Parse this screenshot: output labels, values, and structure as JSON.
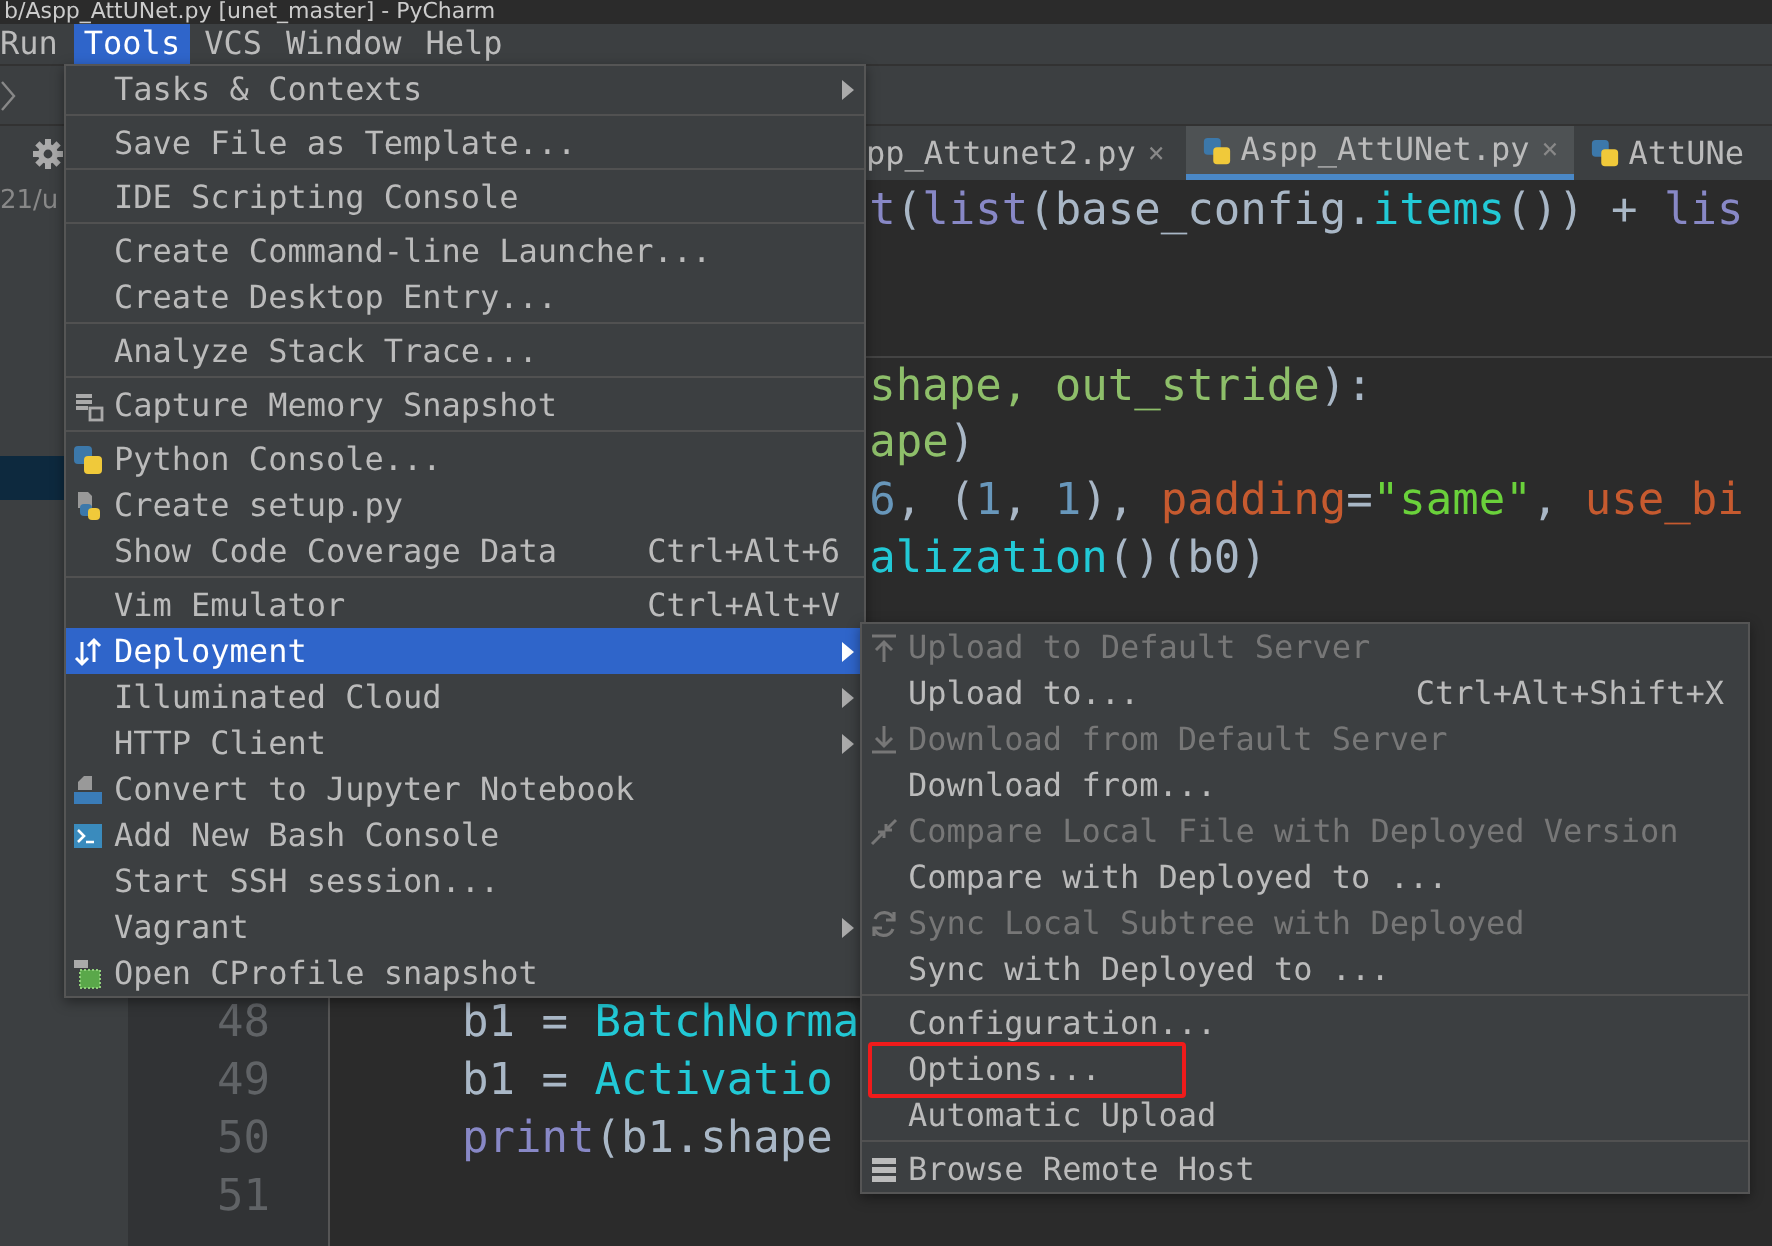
{
  "window": {
    "title": "b/Aspp_AttUNet.py [unet_master] - PyCharm"
  },
  "menu_bar": [
    {
      "label": "Run",
      "selected": false
    },
    {
      "label": "Tools",
      "selected": true
    },
    {
      "label": "VCS",
      "selected": false
    },
    {
      "label": "Window",
      "selected": false
    },
    {
      "label": "Help",
      "selected": false
    }
  ],
  "editor_tabs": [
    {
      "label": "pp_Attunet2.py",
      "selected": false,
      "file_icon": false,
      "close": "×"
    },
    {
      "label": "Aspp_AttUNet.py",
      "selected": true,
      "file_icon": true,
      "close": "×"
    },
    {
      "label": "AttUNe",
      "selected": false,
      "file_icon": true
    }
  ],
  "project_panel": {
    "path_fragment": "21/u",
    "has_selection": true
  },
  "editor": {
    "lines": [
      {
        "tokens": [
          {
            "kind": "builtin",
            "text": "t"
          },
          {
            "kind": "name",
            "text": "("
          },
          {
            "kind": "builtin",
            "text": "list"
          },
          {
            "kind": "name",
            "text": "(base_config."
          },
          {
            "kind": "call",
            "text": "items"
          },
          {
            "kind": "name",
            "text": "()) + "
          },
          {
            "kind": "builtin",
            "text": "lis"
          }
        ]
      },
      {
        "tokens": [
          {
            "kind": "param",
            "text": "shape, out_stride"
          },
          {
            "kind": "name",
            "text": "):"
          }
        ]
      },
      {
        "tokens": [
          {
            "kind": "param",
            "text": "ape"
          },
          {
            "kind": "name",
            "text": ")"
          }
        ]
      },
      {
        "tokens": [
          {
            "kind": "number",
            "text": "6"
          },
          {
            "kind": "name",
            "text": ", ("
          },
          {
            "kind": "number",
            "text": "1"
          },
          {
            "kind": "name",
            "text": ", "
          },
          {
            "kind": "number",
            "text": "1"
          },
          {
            "kind": "name",
            "text": "), "
          },
          {
            "kind": "kwarg",
            "text": "padding"
          },
          {
            "kind": "name",
            "text": "="
          },
          {
            "kind": "string",
            "text": "\"same\""
          },
          {
            "kind": "name",
            "text": ", "
          },
          {
            "kind": "kwarg",
            "text": "use_bi"
          }
        ]
      },
      {
        "tokens": [
          {
            "kind": "call",
            "text": "alization"
          },
          {
            "kind": "name",
            "text": "()(b0)"
          }
        ]
      },
      {
        "number": "48",
        "tokens": [
          {
            "kind": "name",
            "text": "b1 = "
          },
          {
            "kind": "call",
            "text": "BatchNorma"
          }
        ]
      },
      {
        "number": "49",
        "tokens": [
          {
            "kind": "name",
            "text": "b1 = "
          },
          {
            "kind": "call",
            "text": "Activatio"
          }
        ]
      },
      {
        "number": "50",
        "tokens": [
          {
            "kind": "builtin",
            "text": "print"
          },
          {
            "kind": "name",
            "text": "(b1.shape"
          }
        ]
      },
      {
        "number": "51"
      }
    ]
  },
  "tools_menu": {
    "items": [
      {
        "kind": "plain",
        "label": "Tasks & Contexts",
        "submenu": true,
        "selected": false
      },
      {
        "kind": "separator"
      },
      {
        "kind": "plain",
        "label": "Save File as Template...",
        "submenu": false,
        "selected": false
      },
      {
        "kind": "separator"
      },
      {
        "kind": "plain",
        "label": "IDE Scripting Console",
        "submenu": false,
        "selected": false
      },
      {
        "kind": "separator"
      },
      {
        "kind": "plain",
        "label": "Create Command-line Launcher...",
        "submenu": false,
        "selected": false
      },
      {
        "kind": "plain",
        "label": "Create Desktop Entry...",
        "submenu": false,
        "selected": false
      },
      {
        "kind": "separator"
      },
      {
        "kind": "plain",
        "label": "Analyze Stack Trace...",
        "submenu": false,
        "selected": false
      },
      {
        "kind": "separator"
      },
      {
        "kind": "memory",
        "label": "Capture Memory Snapshot",
        "submenu": false,
        "selected": false
      },
      {
        "kind": "separator"
      },
      {
        "kind": "python",
        "label": "Python Console...",
        "submenu": false,
        "selected": false
      },
      {
        "kind": "setup",
        "label": "Create setup.py",
        "submenu": false,
        "selected": false
      },
      {
        "kind": "plain",
        "label": "Show Code Coverage Data",
        "shortcut": "Ctrl+Alt+6",
        "submenu": false,
        "selected": false
      },
      {
        "kind": "separator"
      },
      {
        "kind": "plain",
        "label": "Vim Emulator",
        "shortcut": "Ctrl+Alt+V",
        "submenu": false,
        "selected": false
      },
      {
        "kind": "deploy",
        "label": "Deployment",
        "submenu": true,
        "selected": true
      },
      {
        "kind": "plain",
        "label": "Illuminated Cloud",
        "submenu": true,
        "selected": false
      },
      {
        "kind": "plain",
        "label": "HTTP Client",
        "submenu": true,
        "selected": false
      },
      {
        "kind": "jupyter",
        "label": "Convert to Jupyter Notebook",
        "submenu": false,
        "selected": false
      },
      {
        "kind": "bash",
        "label": "Add New Bash Console",
        "submenu": false,
        "selected": false
      },
      {
        "kind": "plain",
        "label": "Start SSH session...",
        "submenu": false,
        "selected": false
      },
      {
        "kind": "plain",
        "label": "Vagrant",
        "submenu": true,
        "selected": false
      },
      {
        "kind": "profile",
        "label": "Open CProfile snapshot",
        "submenu": false,
        "selected": false
      }
    ]
  },
  "deployment_submenu": {
    "items": [
      {
        "kind": "upload",
        "label": "Upload to Default Server",
        "disabled": true,
        "marked": false
      },
      {
        "kind": "plain",
        "label": "Upload to...",
        "shortcut": "Ctrl+Alt+Shift+X",
        "disabled": false,
        "marked": false
      },
      {
        "kind": "download",
        "label": "Download from Default Server",
        "disabled": true,
        "marked": false
      },
      {
        "kind": "plain",
        "label": "Download from...",
        "disabled": false,
        "marked": false
      },
      {
        "kind": "compare",
        "label": "Compare Local File with Deployed Version",
        "disabled": true,
        "marked": false
      },
      {
        "kind": "plain",
        "label": "Compare with Deployed to ...",
        "disabled": false,
        "marked": false
      },
      {
        "kind": "sync",
        "label": "Sync Local Subtree with Deployed",
        "disabled": true,
        "marked": false
      },
      {
        "kind": "plain",
        "label": "Sync with Deployed to ...",
        "disabled": false,
        "marked": false
      },
      {
        "kind": "separator"
      },
      {
        "kind": "plain",
        "label": "Configuration...",
        "disabled": false,
        "marked": false
      },
      {
        "kind": "plain",
        "label": "Options...",
        "disabled": false,
        "marked": true
      },
      {
        "kind": "plain",
        "label": "Automatic Upload",
        "disabled": false,
        "marked": false
      },
      {
        "kind": "separator"
      },
      {
        "kind": "server",
        "label": "Browse Remote Host",
        "disabled": false,
        "marked": false
      }
    ]
  }
}
